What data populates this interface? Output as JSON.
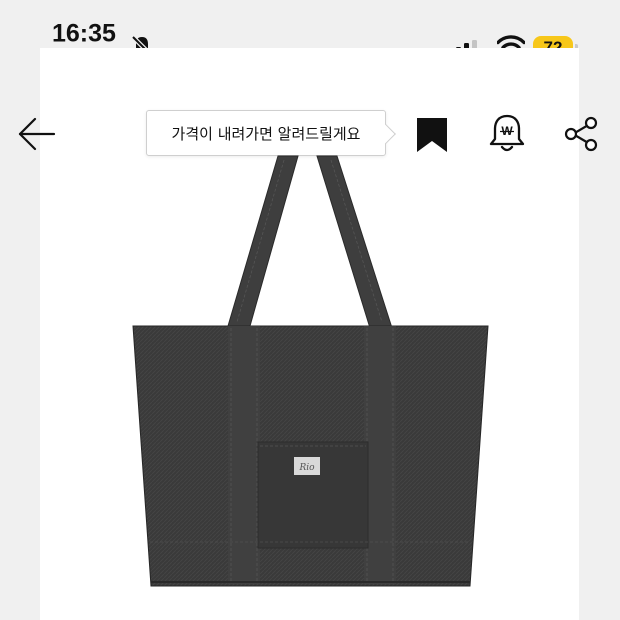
{
  "status_bar": {
    "time": "16:35",
    "mute_icon": "bell-slash-icon",
    "signal_icon": "cellular-signal-icon",
    "wifi_icon": "wifi-icon",
    "battery_level": "72",
    "battery_color": "#f7c71a"
  },
  "header": {
    "back_icon": "arrow-left-icon",
    "price_alert_tooltip": "가격이 내려가면 알려드릴게요",
    "bookmark_icon": "bookmark-icon",
    "price_alert_icon": "price-alert-bell-icon",
    "price_alert_badge": "W",
    "share_icon": "share-icon"
  },
  "product": {
    "image": "dark-gray-denim-tote-bag",
    "label_text": "Rio"
  }
}
